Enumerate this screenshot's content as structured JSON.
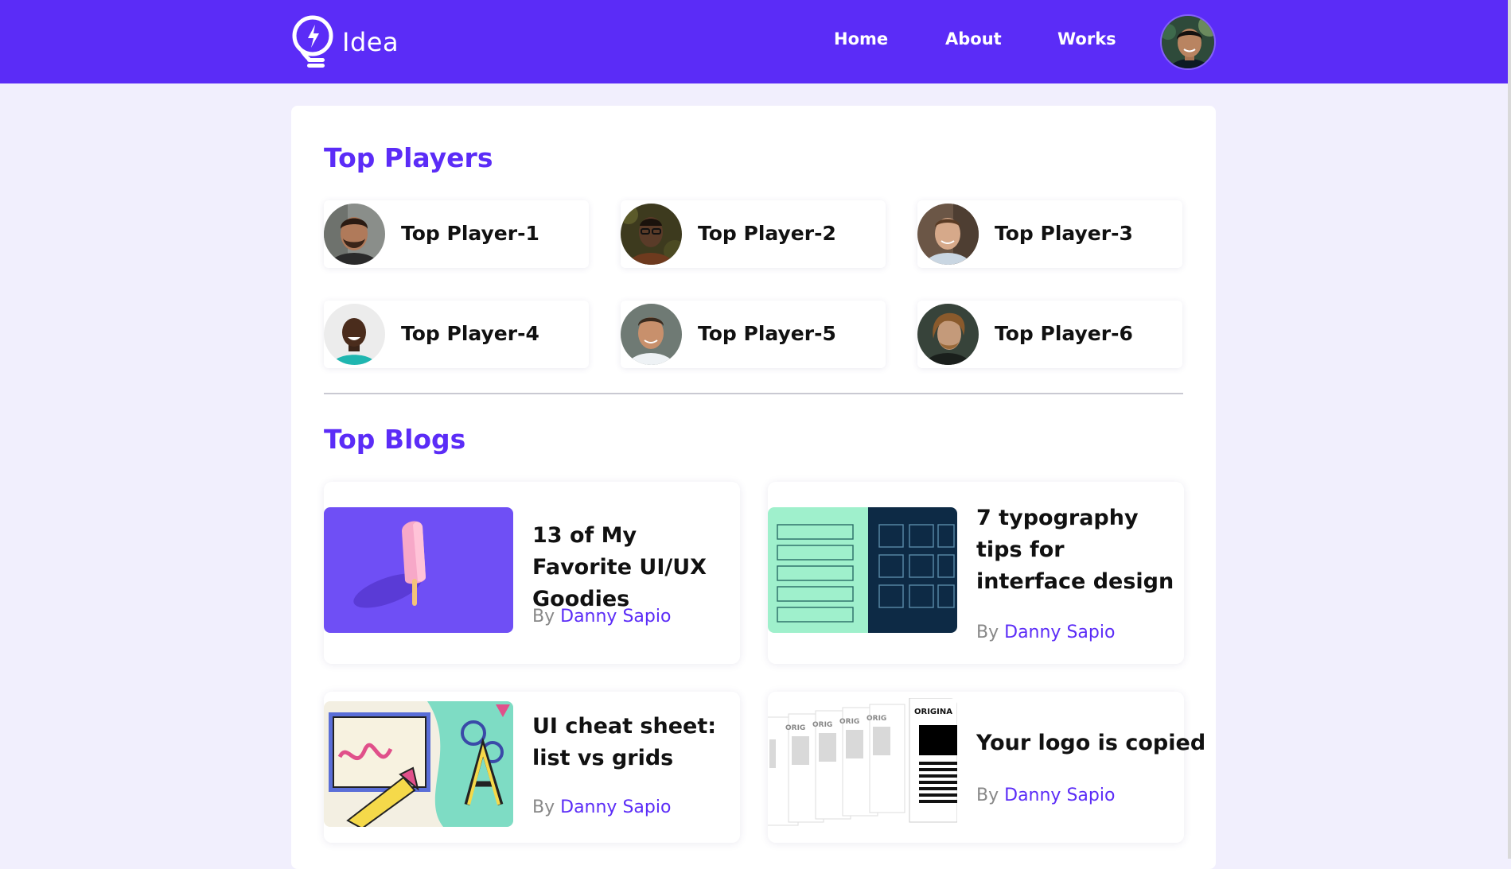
{
  "brand": {
    "name": "Idea"
  },
  "nav": {
    "links": [
      "Home",
      "About",
      "Works"
    ]
  },
  "sections": {
    "players_title": "Top Players",
    "blogs_title": "Top Blogs"
  },
  "players": [
    {
      "name": "Top Player-1"
    },
    {
      "name": "Top Player-2"
    },
    {
      "name": "Top Player-3"
    },
    {
      "name": "Top Player-4"
    },
    {
      "name": "Top Player-5"
    },
    {
      "name": "Top Player-6"
    }
  ],
  "blogs": [
    {
      "title": "13 of My Favorite UI/UX Goodies",
      "by": "By",
      "author": "Danny Sapio"
    },
    {
      "title": "7 typography tips for interface design",
      "by": "By",
      "author": "Danny Sapio"
    },
    {
      "title": "UI cheat sheet: list vs grids",
      "by": "By",
      "author": "Danny Sapio"
    },
    {
      "title": "Your logo is copied",
      "by": "By",
      "author": "Danny Sapio"
    }
  ],
  "thumb_text": {
    "original": "ORIGINA",
    "orig": "ORIG"
  },
  "colors": {
    "brand": "#5b2cf7",
    "page_bg": "#f1effd"
  }
}
